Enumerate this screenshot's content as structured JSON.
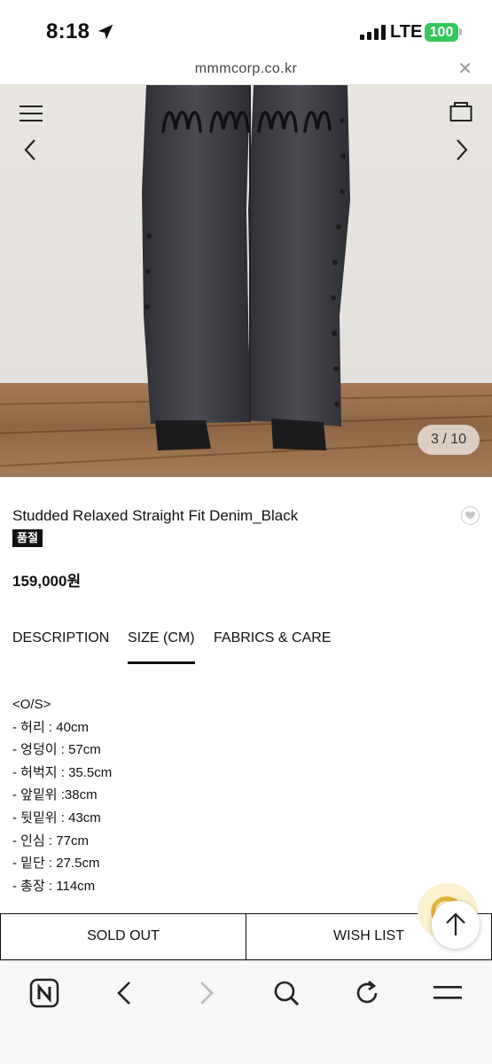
{
  "status_bar": {
    "time": "8:18",
    "network": "LTE",
    "battery": "100",
    "location_icon": "location-arrow-icon"
  },
  "browser": {
    "url": "mmmcorp.co.kr",
    "close_icon": "close-icon"
  },
  "hero": {
    "logo_icon": "mmm-logo-icon",
    "menu_icon": "hamburger-menu-icon",
    "cart_icon": "shopping-bag-icon",
    "prev_icon": "chevron-left-icon",
    "next_icon": "chevron-right-icon",
    "counter": "3 / 10"
  },
  "product": {
    "title": "Studded Relaxed Straight Fit Denim_Black",
    "badge": "품절",
    "price": "159,000원",
    "heart_icon": "heart-icon"
  },
  "tabs": [
    {
      "label": "DESCRIPTION",
      "active": false
    },
    {
      "label": "SIZE (CM)",
      "active": true
    },
    {
      "label": "FABRICS & CARE",
      "active": false
    }
  ],
  "size_info": [
    "<O/S>",
    "- 허리 : 40cm",
    "- 엉덩이 : 57cm",
    "- 허벅지 : 35.5cm",
    "- 앞밑위 :38cm",
    "- 뒷밑위 : 43cm",
    "- 인심 : 77cm",
    "- 밑단 : 27.5cm",
    "- 총장 : 114cm"
  ],
  "buttons": {
    "sold_out": "SOLD OUT",
    "wish_list": "WISH LIST",
    "scroll_top_icon": "arrow-up-icon"
  },
  "toolbar": {
    "items": [
      "naver-home-icon",
      "back-arrow-icon",
      "forward-arrow-icon",
      "search-icon",
      "refresh-icon",
      "menu-icon"
    ]
  },
  "colors": {
    "accent": "#111111",
    "battery": "#34c759",
    "floor": "#a57a55",
    "denim": "#3a3c42"
  }
}
